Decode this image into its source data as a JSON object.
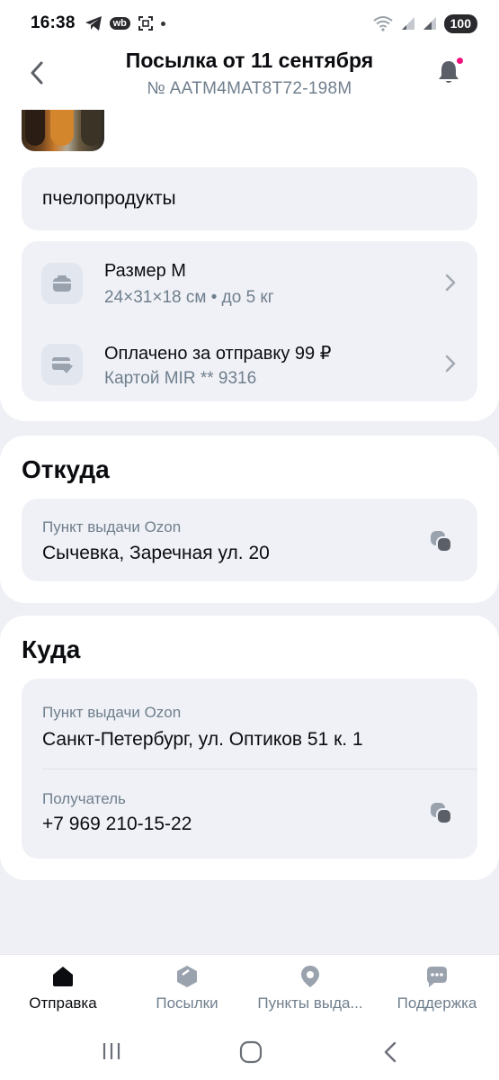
{
  "status_bar": {
    "time": "16:38",
    "wb_badge": "wb",
    "battery": "100"
  },
  "header": {
    "title": "Посылка от 11 сентября",
    "tracking": "№ AATM4MAT8T72-198M",
    "notification_dot_color": "#f1117e"
  },
  "parcel": {
    "description": "пчелопродукты",
    "size": {
      "title": "Размер M",
      "details": "24×31×18 см • до 5 кг"
    },
    "payment": {
      "title": "Оплачено за отправку 99 ₽",
      "details": "Картой MIR ** 9316"
    }
  },
  "from": {
    "heading": "Откуда",
    "pickup_label": "Пункт выдачи Ozon",
    "address": "Сычевка, Заречная ул. 20"
  },
  "to": {
    "heading": "Куда",
    "pickup_label": "Пункт выдачи Ozon",
    "address": "Санкт-Петербург, ул. Оптиков 51 к. 1",
    "recipient_label": "Получатель",
    "recipient_phone": "+7 969 210-15-22"
  },
  "bottom_nav": [
    {
      "label": "Отправка",
      "icon": "home-icon",
      "active": true
    },
    {
      "label": "Посылки",
      "icon": "box-icon",
      "active": false
    },
    {
      "label": "Пункты выда...",
      "icon": "location-pin-icon",
      "active": false
    },
    {
      "label": "Поддержка",
      "icon": "chat-icon",
      "active": false
    }
  ],
  "colors": {
    "background": "#eef0f5",
    "card": "#ffffff",
    "field": "#eff1f6",
    "secondary_text": "#707f8d",
    "active_nav": "#0b0c10",
    "inactive_nav": "#707f8d"
  }
}
